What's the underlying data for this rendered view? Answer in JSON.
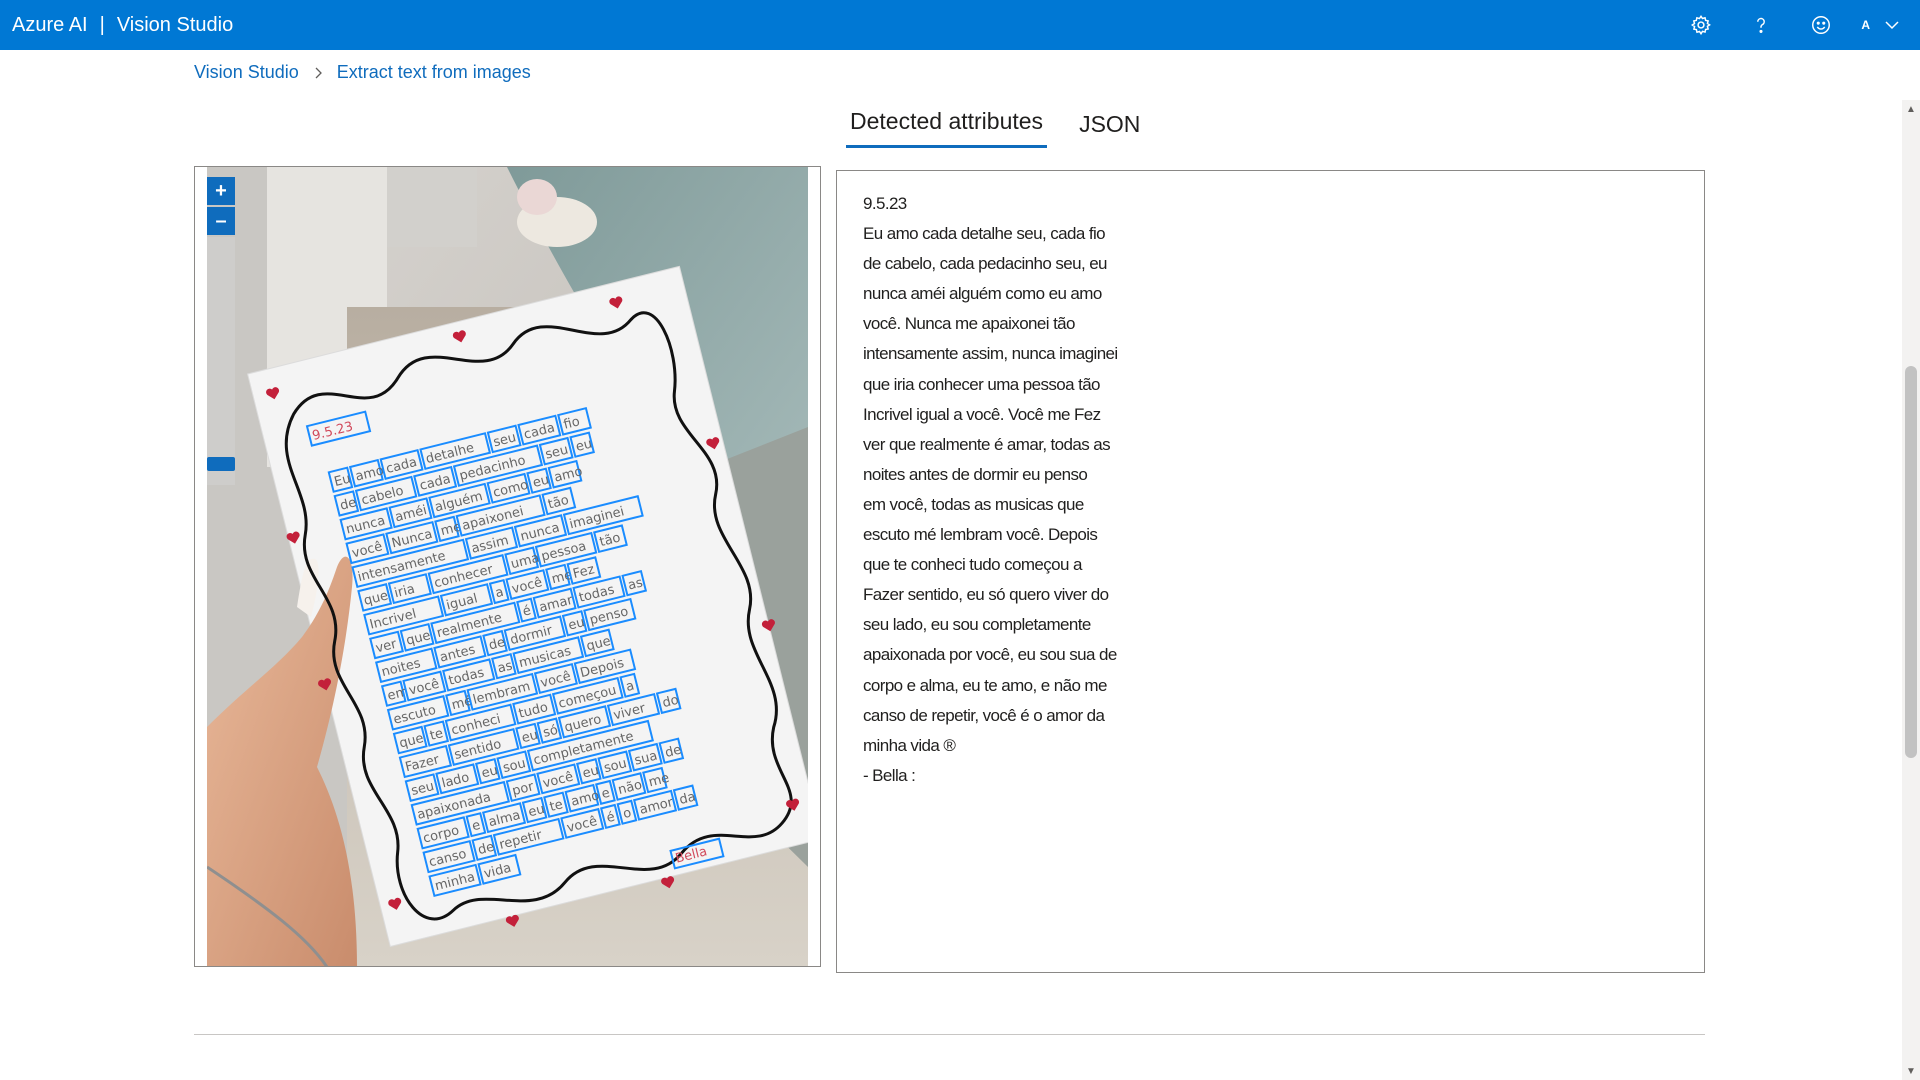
{
  "app": {
    "brand_left": "Azure AI",
    "brand_sep": "|",
    "brand_right": "Vision Studio",
    "account_initial": "A",
    "accent_color": "#0078d4"
  },
  "icons": {
    "settings": "gear-icon",
    "help": "question-icon",
    "feedback": "smiley-icon",
    "account_menu": "chevron-down-icon"
  },
  "breadcrumb": {
    "root": "Vision Studio",
    "current": "Extract text from images"
  },
  "tabs": [
    {
      "label": "Detected attributes",
      "active": true
    },
    {
      "label": "JSON",
      "active": false
    }
  ],
  "zoom": {
    "in_label": "+",
    "out_label": "–"
  },
  "image_words": {
    "date": "9.5.23",
    "lines": [
      [
        "Eu",
        "amo",
        "cada",
        "detalhe",
        "seu",
        "cada",
        "fio"
      ],
      [
        "de",
        "cabelo",
        "cada",
        "pedacinho",
        "seu",
        "eu"
      ],
      [
        "nunca",
        "améi",
        "alguém",
        "como",
        "eu",
        "amo"
      ],
      [
        "você",
        "Nunca",
        "me",
        "apaixonei",
        "tão"
      ],
      [
        "intensamente",
        "assim",
        "nunca",
        "imaginei"
      ],
      [
        "que",
        "iria",
        "conhecer",
        "uma",
        "pessoa",
        "tão"
      ],
      [
        "Incrivel",
        "igual",
        "a",
        "você",
        "me",
        "Fez"
      ],
      [
        "ver",
        "que",
        "realmente",
        "é",
        "amar",
        "todas",
        "as"
      ],
      [
        "noites",
        "antes",
        "de",
        "dormir",
        "eu",
        "penso"
      ],
      [
        "em",
        "você",
        "todas",
        "as",
        "musicas",
        "que"
      ],
      [
        "escuto",
        "mé",
        "lembram",
        "você",
        "Depois"
      ],
      [
        "que",
        "te",
        "conheci",
        "tudo",
        "começou",
        "a"
      ],
      [
        "Fazer",
        "sentido",
        "eu",
        "só",
        "quero",
        "viver",
        "do"
      ],
      [
        "seu",
        "lado",
        "eu",
        "sou",
        "completamente"
      ],
      [
        "apaixonada",
        "por",
        "você",
        "eu",
        "sou",
        "sua",
        "de"
      ],
      [
        "corpo",
        "e",
        "alma",
        "eu",
        "te",
        "amo",
        "e",
        "não",
        "me"
      ],
      [
        "canso",
        "de",
        "repetir",
        "você",
        "é",
        "o",
        "amor",
        "da"
      ],
      [
        "minha",
        "vida"
      ]
    ],
    "signature": "Bella"
  },
  "ocr_text": [
    "9.5.23",
    "Eu amo cada detalhe seu, cada fio",
    "de cabelo, cada pedacinho seu, eu",
    "nunca améi alguém como eu amo",
    "você. Nunca me apaixonei tão",
    "intensamente assim, nunca imaginei",
    "que iria conhecer uma pessoa tão",
    "Incrivel igual a você. Você me Fez",
    "ver que realmente é amar, todas as",
    "noites antes de dormir eu penso",
    "em você, todas as musicas que",
    "escuto mé lembram você. Depois",
    "que te conheci tudo começou a",
    "Fazer sentido, eu só quero viver do",
    "seu lado, eu sou completamente",
    "apaixonada por você, eu sou sua de",
    "corpo e alma, eu te amo, e não me",
    "canso de repetir, você é o amor da",
    "minha vida ®",
    "- Bella :"
  ]
}
